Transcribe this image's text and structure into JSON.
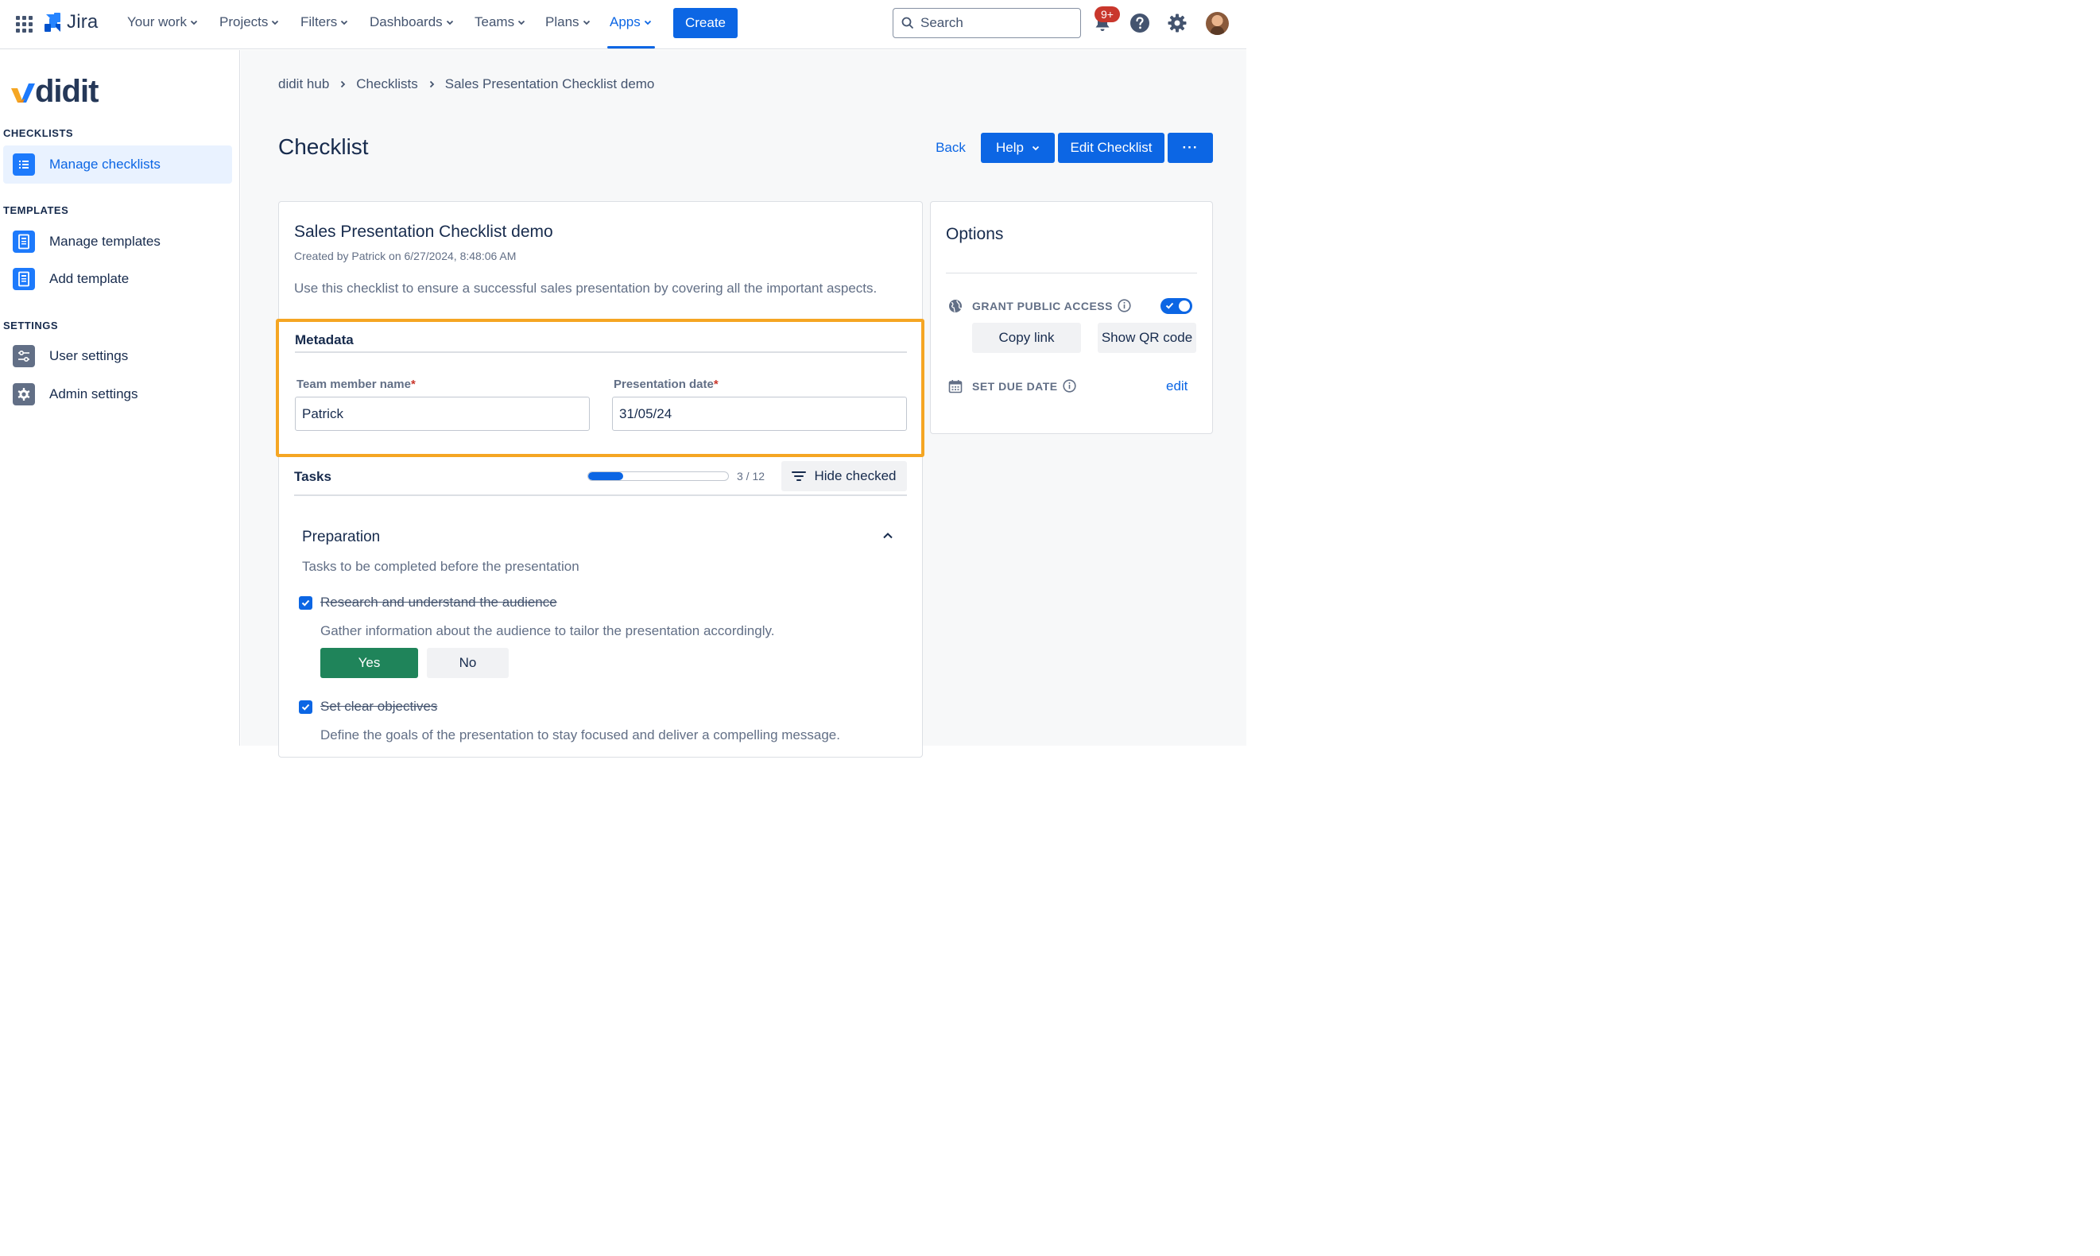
{
  "topnav": {
    "logo_text": "Jira",
    "items": [
      {
        "label": "Your work"
      },
      {
        "label": "Projects"
      },
      {
        "label": "Filters"
      },
      {
        "label": "Dashboards"
      },
      {
        "label": "Teams"
      },
      {
        "label": "Plans"
      },
      {
        "label": "Apps"
      }
    ],
    "active_item": "Apps",
    "create_label": "Create",
    "search_placeholder": "Search",
    "notifications_badge": "9+",
    "icons": [
      "app-switcher-icon",
      "jira-logo-icon",
      "search-icon",
      "notifications-icon",
      "help-icon",
      "settings-icon"
    ],
    "accent_color": "#0c66e4"
  },
  "sidebar": {
    "logo_text": "didit",
    "sections": [
      {
        "label": "CHECKLISTS",
        "items": [
          {
            "label": "Manage checklists",
            "icon": "list-icon",
            "active": true
          }
        ]
      },
      {
        "label": "TEMPLATES",
        "items": [
          {
            "label": "Manage templates",
            "icon": "template-icon"
          },
          {
            "label": "Add template",
            "icon": "template-icon"
          }
        ]
      },
      {
        "label": "SETTINGS",
        "items": [
          {
            "label": "User settings",
            "icon": "sliders-icon"
          },
          {
            "label": "Admin settings",
            "icon": "gear-icon"
          }
        ]
      }
    ]
  },
  "breadcrumb": [
    "didit hub",
    "Checklists",
    "Sales Presentation Checklist demo"
  ],
  "page": {
    "title": "Checklist",
    "back_label": "Back",
    "help_label": "Help",
    "edit_label": "Edit Checklist",
    "more_label": "···"
  },
  "checklist": {
    "title": "Sales Presentation Checklist demo",
    "created": "Created by Patrick on 6/27/2024, 8:48:06 AM",
    "description": "Use this checklist to ensure a successful sales presentation by covering all the important aspects."
  },
  "metadata": {
    "title": "Metadata",
    "fields": [
      {
        "label": "Team member name",
        "required_mark": "*",
        "value": "Patrick"
      },
      {
        "label": "Presentation date",
        "required_mark": "*",
        "value": "31/05/24"
      }
    ],
    "highlight_color": "#f5a623"
  },
  "tasks": {
    "label": "Tasks",
    "done": 3,
    "total": 12,
    "progress_text": "3 / 12",
    "hide_checked_label": "Hide checked",
    "section": {
      "title": "Preparation",
      "description": "Tasks to be completed before the presentation",
      "items": [
        {
          "name": "Research and understand the audience",
          "description": "Gather information about the audience to tailor the presentation accordingly.",
          "checked": true
        },
        {
          "name": "Set clear objectives",
          "description": "Define the goals of the presentation to stay focused and deliver a compelling message.",
          "checked": true
        }
      ],
      "yes_label": "Yes",
      "no_label": "No",
      "yes_color": "#1f845a"
    }
  },
  "options": {
    "title": "Options",
    "public_access_label": "GRANT PUBLIC ACCESS",
    "public_access_enabled": true,
    "copy_link_label": "Copy link",
    "qr_label": "Show QR code",
    "due_date_label": "SET DUE DATE",
    "edit_label": "edit"
  }
}
